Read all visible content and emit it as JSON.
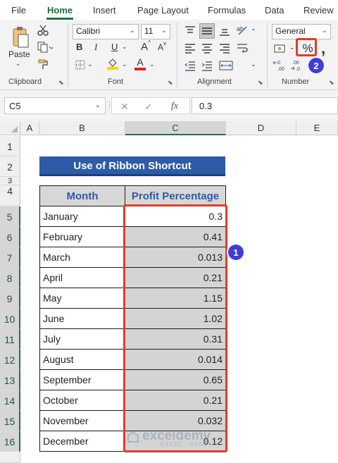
{
  "menu": {
    "tabs": [
      "File",
      "Home",
      "Insert",
      "Page Layout",
      "Formulas",
      "Data",
      "Review"
    ],
    "active": "Home"
  },
  "ribbon": {
    "clipboard": {
      "paste_label": "Paste",
      "group_label": "Clipboard"
    },
    "font": {
      "name": "Calibri",
      "size": "11",
      "bold": "B",
      "italic": "I",
      "underline": "U",
      "grow": "A",
      "shrink": "A",
      "fill_letter": "A",
      "font_color_letter": "A",
      "group_label": "Font"
    },
    "alignment": {
      "group_label": "Alignment"
    },
    "number": {
      "format": "General",
      "percent": "%",
      "comma": ",",
      "group_label": "Number"
    },
    "callout_number": "2",
    "colors": {
      "highlight": "#e03c2b",
      "callout": "#3d3ddb",
      "fill_yellow": "#ffd400",
      "font_red": "#e32020"
    }
  },
  "formula_bar": {
    "name_box": "C5",
    "cancel_icon": "✕",
    "enter_icon": "✓",
    "fx": "fx",
    "formula": "0.3"
  },
  "grid": {
    "columns": [
      "A",
      "B",
      "C",
      "D",
      "E"
    ],
    "rows": [
      "1",
      "2",
      "3",
      "4",
      "5",
      "6",
      "7",
      "8",
      "9",
      "10",
      "11",
      "12",
      "13",
      "14",
      "15",
      "16"
    ]
  },
  "sheet": {
    "title": "Use of Ribbon Shortcut",
    "headers": [
      "Month",
      "Profit Percentage"
    ],
    "rows": [
      {
        "month": "January",
        "value": "0.3"
      },
      {
        "month": "February",
        "value": "0.41"
      },
      {
        "month": "March",
        "value": "0.013"
      },
      {
        "month": "April",
        "value": "0.21"
      },
      {
        "month": "May",
        "value": "1.15"
      },
      {
        "month": "June",
        "value": "1.02"
      },
      {
        "month": "July",
        "value": "0.31"
      },
      {
        "month": "August",
        "value": "0.014"
      },
      {
        "month": "September",
        "value": "0.65"
      },
      {
        "month": "October",
        "value": "0.21"
      },
      {
        "month": "November",
        "value": "0.032"
      },
      {
        "month": "December",
        "value": "0.12"
      }
    ],
    "callout_number": "1"
  },
  "watermark": {
    "name": "exceldemy",
    "tagline": "EXCEL · DATA · BI"
  }
}
